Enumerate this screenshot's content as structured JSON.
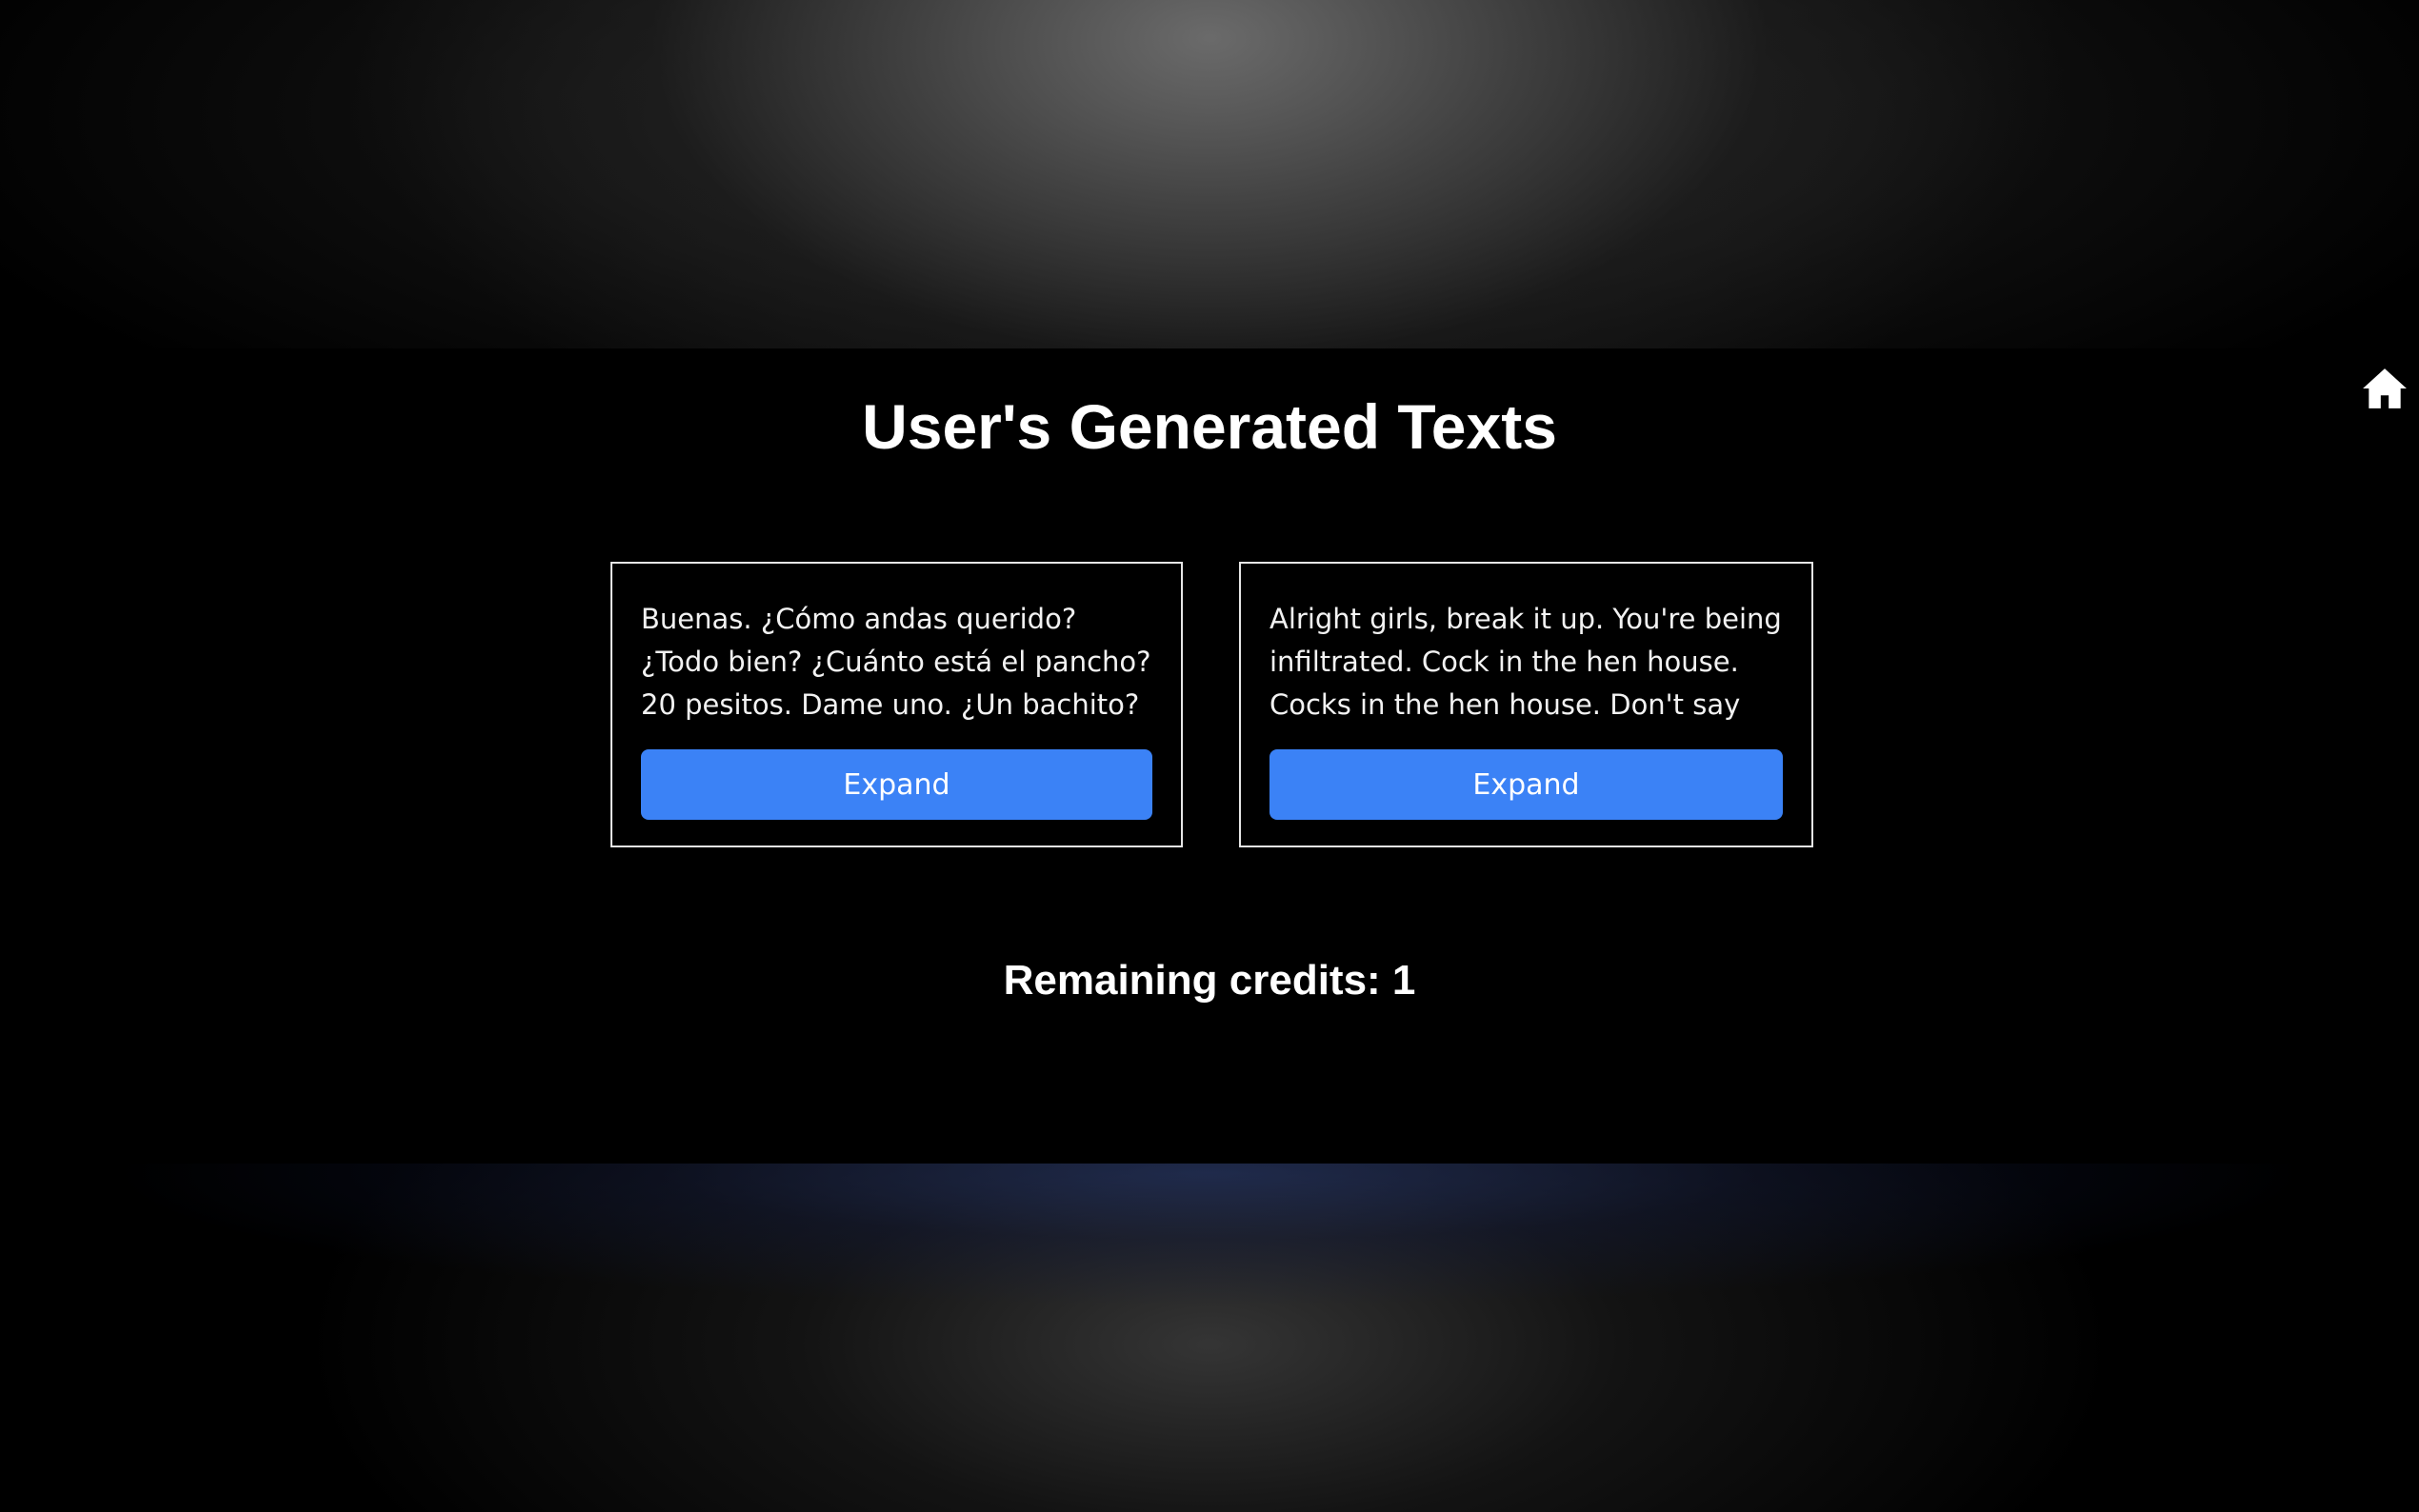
{
  "header": {
    "title": "User's Generated Texts",
    "home_icon": "home-icon"
  },
  "cards": [
    {
      "text": "Buenas. ¿Cómo andas querido? ¿Todo bien? ¿Cuánto está el pancho? 20 pesitos. Dame uno. ¿Un bachito? Perfecto. ¿Algo para tomar? No.",
      "expand_label": "Expand"
    },
    {
      "text": "Alright girls, break it up. You're being infiltrated. Cock in the hen house. Cocks in the hen house. Don't say nothing.",
      "expand_label": "Expand"
    }
  ],
  "footer": {
    "credits_text": "Remaining credits: 1"
  },
  "colors": {
    "background": "#000000",
    "accent_button": "#3b82f6",
    "card_border": "#e6e6e6",
    "text": "#ffffff"
  }
}
